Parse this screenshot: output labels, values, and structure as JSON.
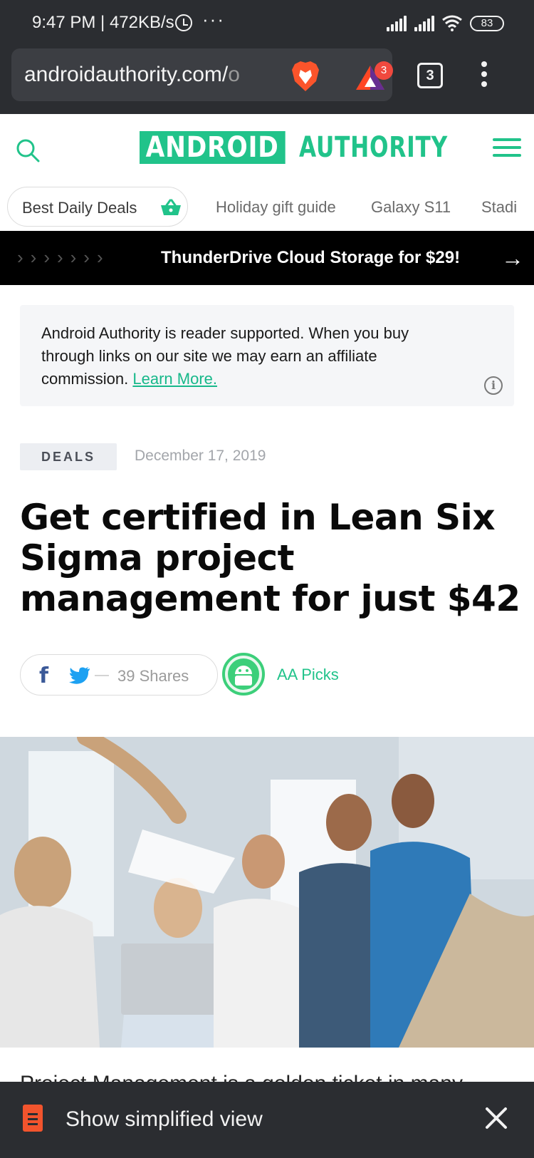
{
  "status_bar": {
    "time": "9:47 PM | 472KB/s",
    "battery": "83"
  },
  "browser": {
    "url_main": "androidauthority.com/",
    "url_faded": "o",
    "shields_badge": "3",
    "tab_count": "3"
  },
  "site": {
    "logo_boxed": "ANDROID",
    "logo_text": "AUTHORITY",
    "accent_color": "#21c38a"
  },
  "nav": {
    "chips": [
      {
        "label": "Best Daily Deals"
      },
      {
        "label": "Holiday gift guide"
      },
      {
        "label": "Galaxy S11"
      },
      {
        "label": "Stadi"
      }
    ]
  },
  "promo": {
    "text": "ThunderDrive Cloud Storage for $29!"
  },
  "notice": {
    "text": "Android Authority is reader supported. When you buy through links on our site we may earn an affiliate commission.",
    "link": "Learn More."
  },
  "article": {
    "tag": "DEALS",
    "date": "December 17, 2019",
    "title": "Get certified in Lean Six Sigma project management for just $42",
    "shares": "39 Shares",
    "author": "AA Picks",
    "teaser": "Project Management is a golden ticket in many"
  },
  "bottom_bar": {
    "label": "Show simplified view"
  }
}
